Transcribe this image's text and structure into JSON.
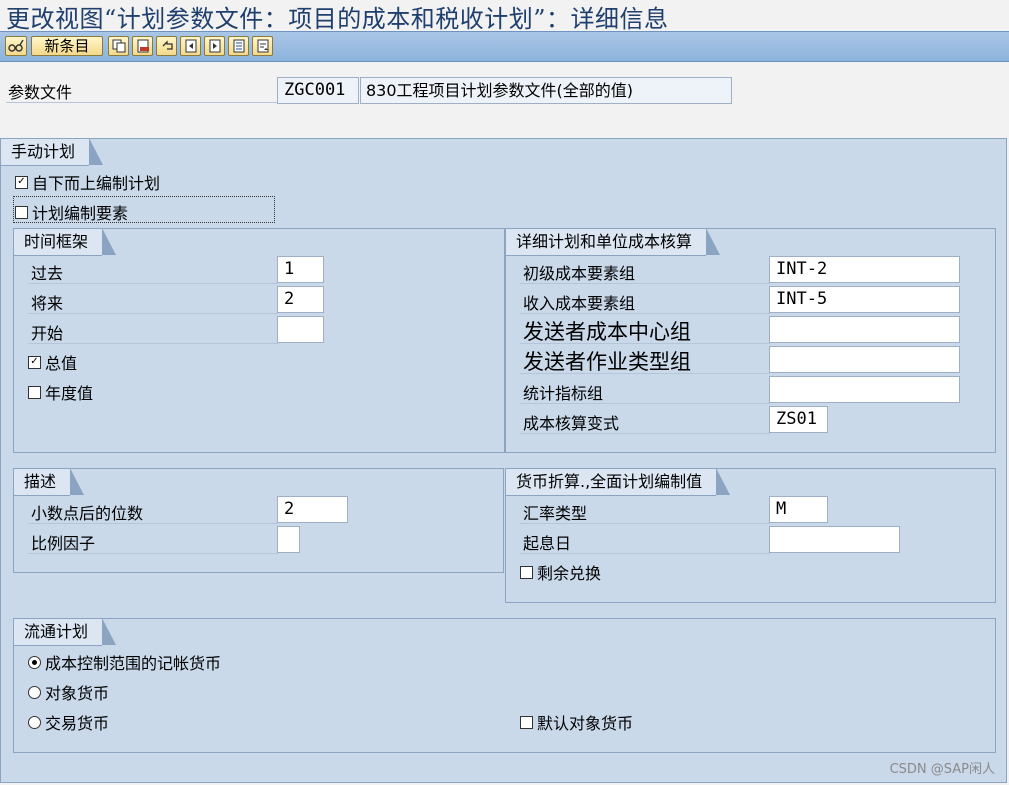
{
  "title": "更改视图“计划参数文件：项目的成本和税收计划”：详细信息",
  "toolbar": {
    "new_entries_label": "新条目",
    "icons": [
      "glasses-edit-icon",
      "copy-icon",
      "delete-icon",
      "undo-icon",
      "previous-entry-icon",
      "next-entry-icon",
      "select-all-icon",
      "transport-icon"
    ]
  },
  "profile": {
    "label": "参数文件",
    "code": "ZGC001",
    "description": "830工程项目计划参数文件(全部的值)"
  },
  "manual_planning": {
    "title": "手动计划",
    "bottom_up": {
      "label": "自下而上编制计划",
      "checked": "☑"
    },
    "planning_elements": {
      "label": "计划编制要素",
      "checked": "☐"
    }
  },
  "time_frame": {
    "title": "时间框架",
    "past_label": "过去",
    "past_value": "1",
    "future_label": "将来",
    "future_value": "2",
    "start_label": "开始",
    "start_value": "",
    "total_values": {
      "label": "总值",
      "checked": "☑"
    },
    "annual_values": {
      "label": "年度值",
      "checked": "☐"
    }
  },
  "detail_planning": {
    "title": "详细计划和单位成本核算",
    "primary_cost_label": "初级成本要素组",
    "primary_cost_value": "INT-2",
    "revenue_label": "收入成本要素组",
    "revenue_value": "INT-5",
    "sender_cc_label": "发送者成本中心组",
    "sender_cc_value": "",
    "sender_activity_label": "发送者作业类型组",
    "sender_activity_value": "",
    "stat_key_label": "统计指标组",
    "stat_key_value": "",
    "costing_variant_label": "成本核算变式",
    "costing_variant_value": "ZS01"
  },
  "representation": {
    "title": "描述",
    "decimal_label": "小数点后的位数",
    "decimal_value": "2",
    "scaling_label": "比例因子",
    "scaling_value": ""
  },
  "currency_translation": {
    "title": "货币折算.,全面计划编制值",
    "exchange_rate_label": "汇率类型",
    "exchange_rate_value": "M",
    "value_date_label": "起息日",
    "value_date_value": "",
    "remainder": {
      "label": "剩余兑换",
      "checked": "☐"
    }
  },
  "currency_planning": {
    "title": "流通计划",
    "options": [
      {
        "label": "成本控制范围的记帐货币",
        "selected": true
      },
      {
        "label": "对象货币",
        "selected": false
      },
      {
        "label": "交易货币",
        "selected": false
      }
    ],
    "default_object_currency": {
      "label": "默认对象货币",
      "checked": "☐"
    }
  },
  "watermark": "CSDN @SAP闲人"
}
